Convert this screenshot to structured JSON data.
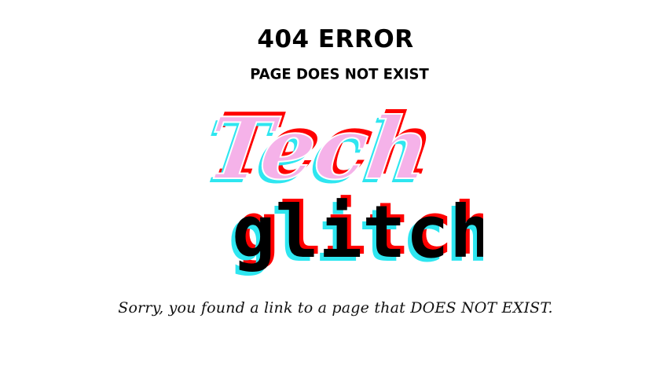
{
  "error": {
    "title": "404 ERROR",
    "subtitle": "PAGE DOES NOT EXIST",
    "message": "Sorry, you found a link to a page that DOES NOT EXIST."
  },
  "logo": {
    "word_top": "Tech",
    "word_bottom": "glitch",
    "colors": {
      "red": "#ff0000",
      "cyan": "#2ee6f0",
      "pink": "#f5b2e9",
      "black": "#000000"
    }
  }
}
